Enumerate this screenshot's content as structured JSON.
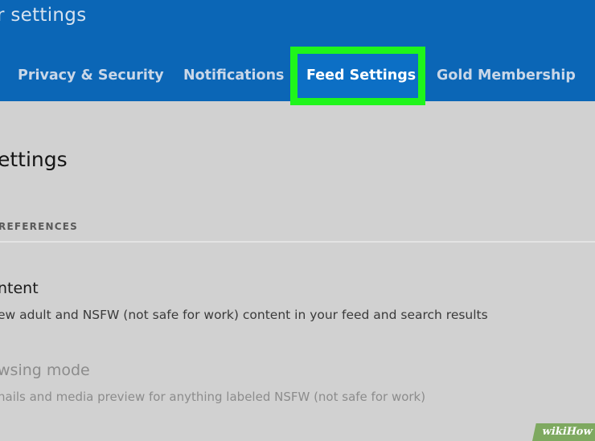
{
  "header": {
    "title": "r settings",
    "tabs": [
      {
        "label": "Privacy & Security",
        "active": false
      },
      {
        "label": "Notifications",
        "active": false
      },
      {
        "label": "Feed Settings",
        "active": true
      },
      {
        "label": "Gold Membership",
        "active": false
      }
    ]
  },
  "main": {
    "title": "ettings",
    "section_label": "REFERENCES",
    "rows": [
      {
        "title": "ntent",
        "description": "ew adult and NSFW (not safe for work) content in your feed and search results"
      },
      {
        "title": "wsing mode",
        "description": "nails and media preview for anything labeled NSFW (not safe for work)"
      }
    ]
  },
  "watermark": "wikiHow",
  "colors": {
    "header_bg": "#0b66b6",
    "highlight": "#1ff51b",
    "content_bg": "#d1d1d1"
  }
}
